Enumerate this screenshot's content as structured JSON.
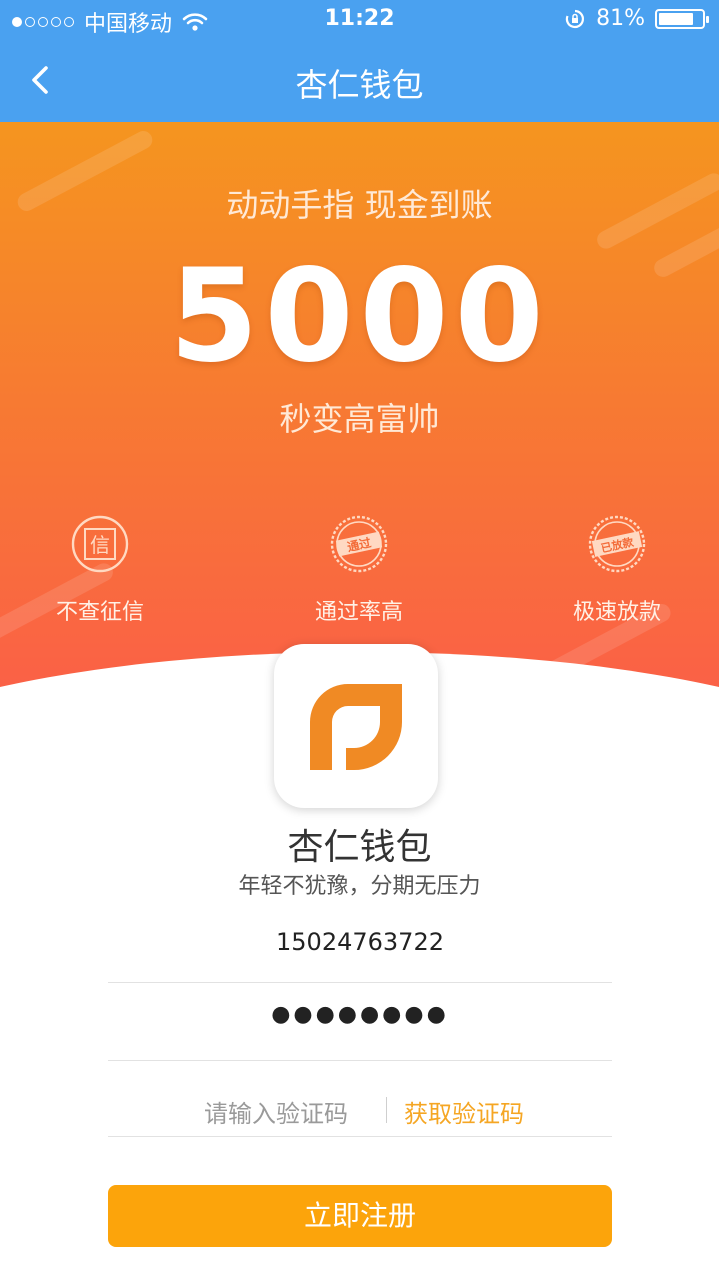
{
  "status_bar": {
    "carrier": "中国移动",
    "time": "11:22",
    "battery_pct": "81%",
    "battery_level": 0.81
  },
  "nav": {
    "title": "杏仁钱包",
    "back_icon": "chevron-left-icon"
  },
  "hero": {
    "headline": "动动手指 现金到账",
    "amount": "5000",
    "tagline": "秒变高富帅",
    "features": [
      {
        "label": "不查征信",
        "icon": "credit-seal-icon",
        "stamp": "信"
      },
      {
        "label": "通过率高",
        "icon": "approved-stamp-icon",
        "stamp": "通过"
      },
      {
        "label": "极速放款",
        "icon": "disbursed-stamp-icon",
        "stamp": "已放款"
      }
    ]
  },
  "app": {
    "name": "杏仁钱包",
    "slogan": "年轻不犹豫，分期无压力"
  },
  "form": {
    "phone_value": "15024763722",
    "password_masked": "●●●●●●●●",
    "code_placeholder": "请输入验证码",
    "get_code_label": "获取验证码",
    "submit_label": "立即注册"
  },
  "colors": {
    "nav_blue": "#4aa1f0",
    "hero_top": "#f5951f",
    "hero_bottom": "#fb5c4a",
    "accent_orange": "#fca40b",
    "logo_orange": "#f08a24"
  }
}
